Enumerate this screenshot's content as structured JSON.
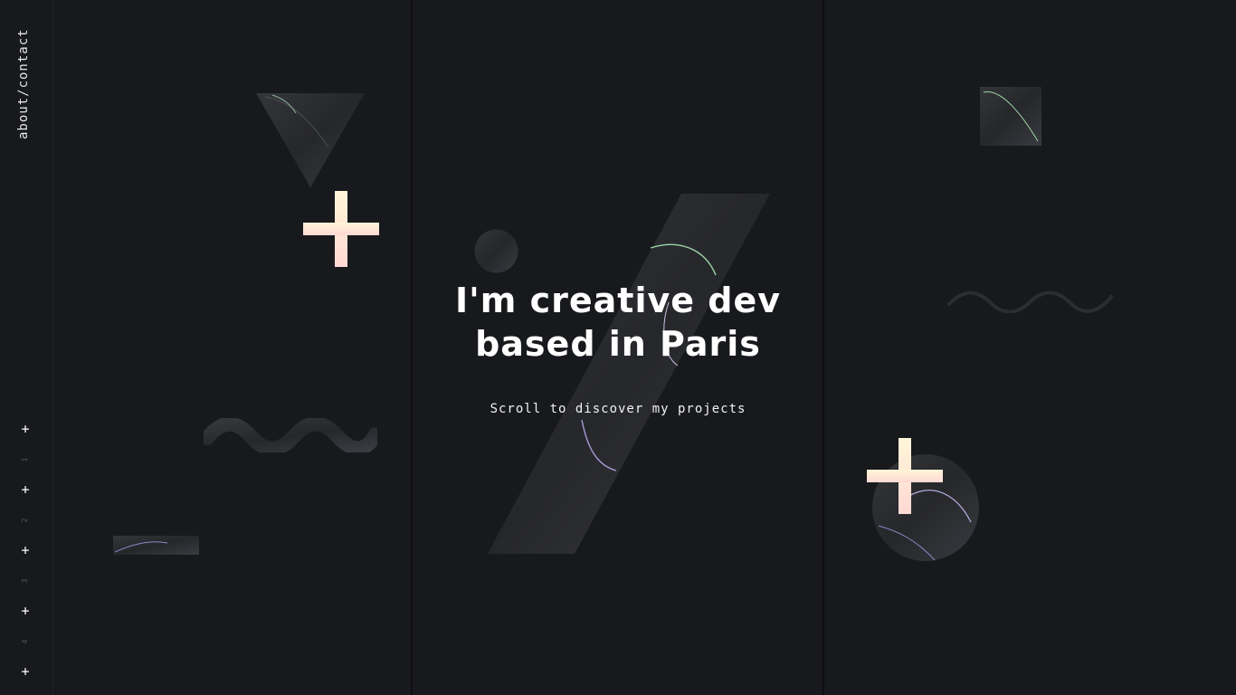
{
  "nav": {
    "about_contact": "about/contact",
    "plus_glyph": "+",
    "steps": [
      "1",
      "2",
      "3",
      "4"
    ]
  },
  "hero": {
    "headline_line1": "I'm creative dev",
    "headline_line2": "based in Paris",
    "scroll_hint": "Scroll to discover my projects"
  },
  "colors": {
    "background": "#18191c",
    "divider": "#0e0e10",
    "text": "#ffffff",
    "muted": "#55565a",
    "accent_plus_top": "#fff4d6",
    "accent_plus_bottom": "#ffd9d6",
    "marble": "#2e2f33"
  },
  "icons": {
    "decor_plus": "plus-icon",
    "decor_triangle": "triangle-shape",
    "decor_wave": "wave-shape",
    "decor_slash": "slash-shape",
    "decor_circle": "circle-shape",
    "decor_square": "square-shape"
  }
}
